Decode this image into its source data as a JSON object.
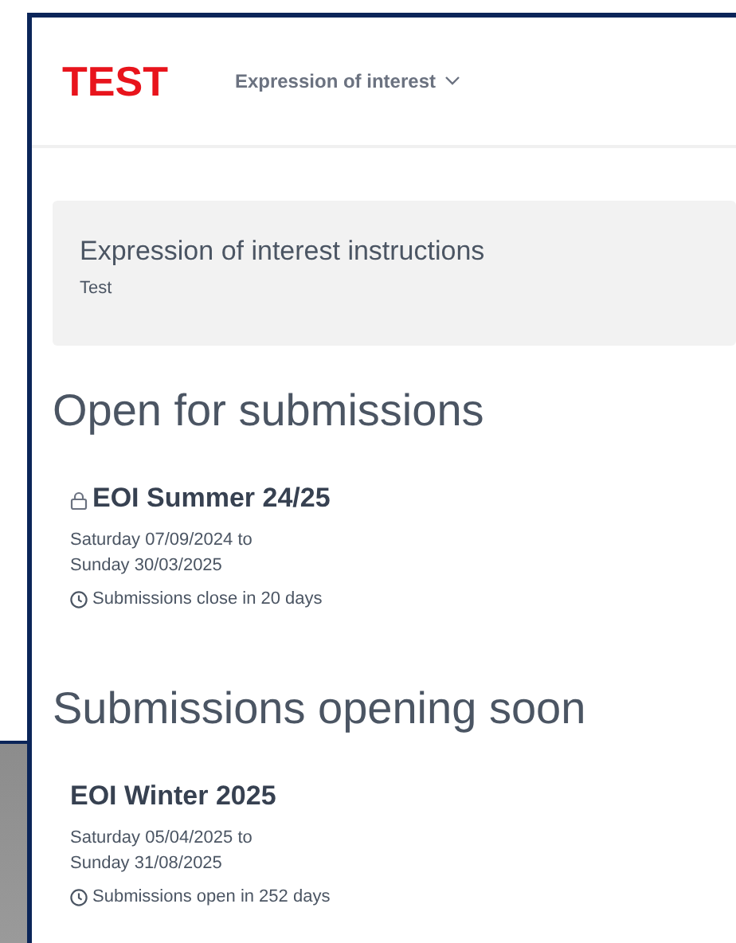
{
  "header": {
    "logo": "TEST",
    "nav": {
      "label": "Expression of interest",
      "expanded": false
    }
  },
  "instructions": {
    "title": "Expression of interest instructions",
    "text": "Test"
  },
  "sections": [
    {
      "heading": "Open for submissions",
      "items": [
        {
          "title": "EOI Summer 24/25",
          "locked": true,
          "dates": [
            "Saturday 07/09/2024 to",
            "Sunday 30/03/2025"
          ],
          "status": "Submissions close in 20 days"
        }
      ]
    },
    {
      "heading": "Submissions opening soon",
      "items": [
        {
          "title": "EOI Winter 2025",
          "locked": false,
          "dates": [
            "Saturday 05/04/2025 to",
            "Sunday 31/08/2025"
          ],
          "status": "Submissions open in 252 days"
        }
      ]
    }
  ]
}
